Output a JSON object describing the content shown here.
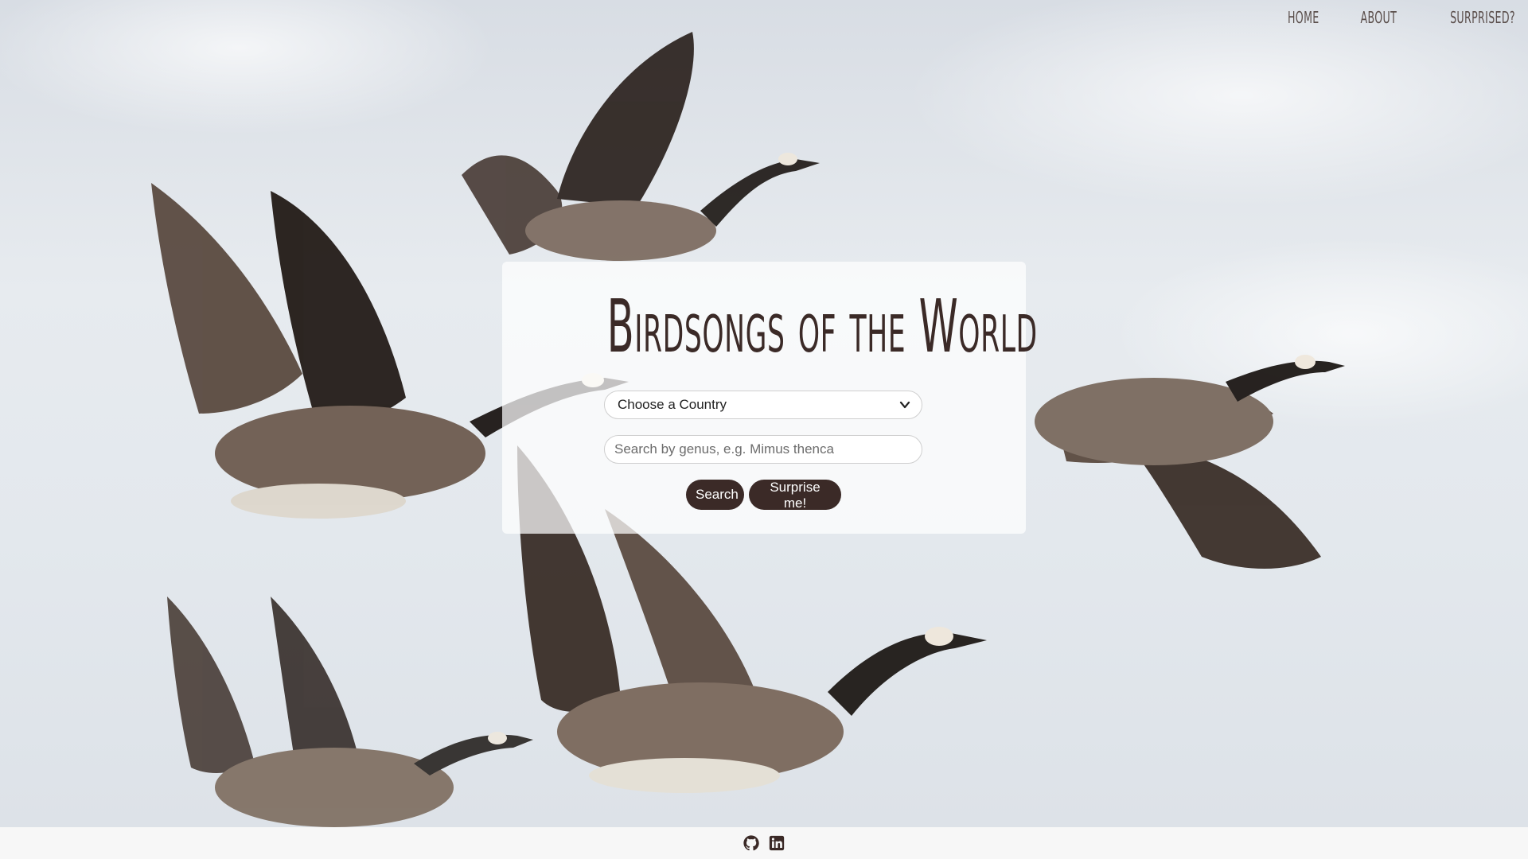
{
  "nav": {
    "home": "HOME",
    "about": "ABOUT",
    "surprised": "SURPRISED?"
  },
  "hero": {
    "title": "Birdsongs of the World"
  },
  "search": {
    "country_selected": "Choose a Country",
    "genus_placeholder": "Search by genus, e.g. Mimus thenca",
    "search_label": "Search",
    "surprise_label": "Surprise me!"
  },
  "footer": {
    "icons": [
      "github-icon",
      "linkedin-icon"
    ]
  },
  "colors": {
    "primary": "#3b2a27",
    "footer_bg": "#f7f7f7",
    "nav_text": "#5a4e4b"
  }
}
